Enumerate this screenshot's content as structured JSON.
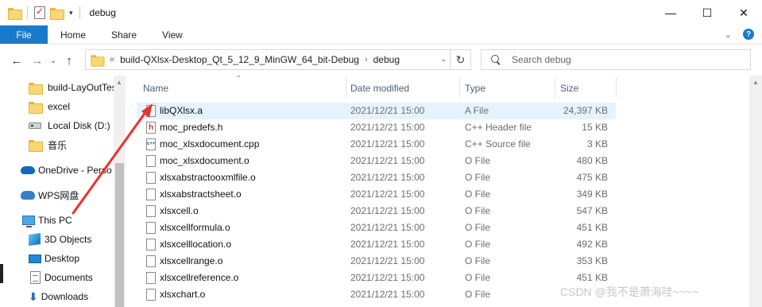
{
  "window": {
    "title": "debug",
    "controls": {
      "minimize": "—",
      "maximize": "☐",
      "close": "✕"
    }
  },
  "quick_access": {
    "dropdown": "▾"
  },
  "ribbon": {
    "tabs": [
      "File",
      "Home",
      "Share",
      "View"
    ],
    "expand": "⌄",
    "help": "?"
  },
  "nav": {
    "back": "←",
    "forward": "→",
    "recent": "⌄",
    "up": "↑",
    "breadcrumb": {
      "overflow": "«",
      "parts": [
        "build-QXlsx-Desktop_Qt_5_12_9_MinGW_64_bit-Debug",
        "debug"
      ],
      "separator": "›"
    },
    "dropdown": "⌄",
    "refresh": "↻"
  },
  "search": {
    "placeholder": "Search debug"
  },
  "sidebar": {
    "items": [
      {
        "label": "build-LayOutTes",
        "icon": "folder-icon"
      },
      {
        "label": "excel",
        "icon": "folder-icon"
      },
      {
        "label": "Local Disk (D:)",
        "icon": "drive-icon"
      },
      {
        "label": "音乐",
        "icon": "folder-icon"
      },
      {
        "label": "OneDrive - Perso",
        "icon": "onedrive-cloud-icon"
      },
      {
        "label": "WPS网盘",
        "icon": "wps-cloud-icon"
      },
      {
        "label": "This PC",
        "icon": "computer-icon"
      },
      {
        "label": "3D Objects",
        "icon": "3d-objects-icon"
      },
      {
        "label": "Desktop",
        "icon": "desktop-icon"
      },
      {
        "label": "Documents",
        "icon": "documents-icon"
      },
      {
        "label": "Downloads",
        "icon": "downloads-icon"
      }
    ]
  },
  "columns": {
    "name": "Name",
    "date": "Date modified",
    "type": "Type",
    "size": "Size",
    "sort_indicator": "⌃"
  },
  "files": [
    {
      "name": "libQXlsx.a",
      "date": "2021/12/21 15:00",
      "type": "A File",
      "size": "24,397 KB",
      "icon": "file-icon",
      "selected": true
    },
    {
      "name": "moc_predefs.h",
      "date": "2021/12/21 15:00",
      "type": "C++ Header file",
      "size": "15 KB",
      "icon": "header-file-icon"
    },
    {
      "name": "moc_xlsxdocument.cpp",
      "date": "2021/12/21 15:00",
      "type": "C++ Source file",
      "size": "3 KB",
      "icon": "cpp-file-icon"
    },
    {
      "name": "moc_xlsxdocument.o",
      "date": "2021/12/21 15:00",
      "type": "O File",
      "size": "480 KB",
      "icon": "file-icon"
    },
    {
      "name": "xlsxabstractooxmlfile.o",
      "date": "2021/12/21 15:00",
      "type": "O File",
      "size": "475 KB",
      "icon": "file-icon"
    },
    {
      "name": "xlsxabstractsheet.o",
      "date": "2021/12/21 15:00",
      "type": "O File",
      "size": "349 KB",
      "icon": "file-icon"
    },
    {
      "name": "xlsxcell.o",
      "date": "2021/12/21 15:00",
      "type": "O File",
      "size": "547 KB",
      "icon": "file-icon"
    },
    {
      "name": "xlsxcellformula.o",
      "date": "2021/12/21 15:00",
      "type": "O File",
      "size": "451 KB",
      "icon": "file-icon"
    },
    {
      "name": "xlsxcelllocation.o",
      "date": "2021/12/21 15:00",
      "type": "O File",
      "size": "492 KB",
      "icon": "file-icon"
    },
    {
      "name": "xlsxcellrange.o",
      "date": "2021/12/21 15:00",
      "type": "O File",
      "size": "353 KB",
      "icon": "file-icon"
    },
    {
      "name": "xlsxcellreference.o",
      "date": "2021/12/21 15:00",
      "type": "O File",
      "size": "451 KB",
      "icon": "file-icon"
    },
    {
      "name": "xlsxchart.o",
      "date": "2021/12/21 15:00",
      "type": "O File",
      "size": "",
      "icon": "file-icon"
    }
  ],
  "colors": {
    "accent": "#1979ca",
    "selection": "#e5f3ff",
    "arrow": "#e8332a"
  },
  "watermark": "CSDN @我不是萧海哇~~~~"
}
